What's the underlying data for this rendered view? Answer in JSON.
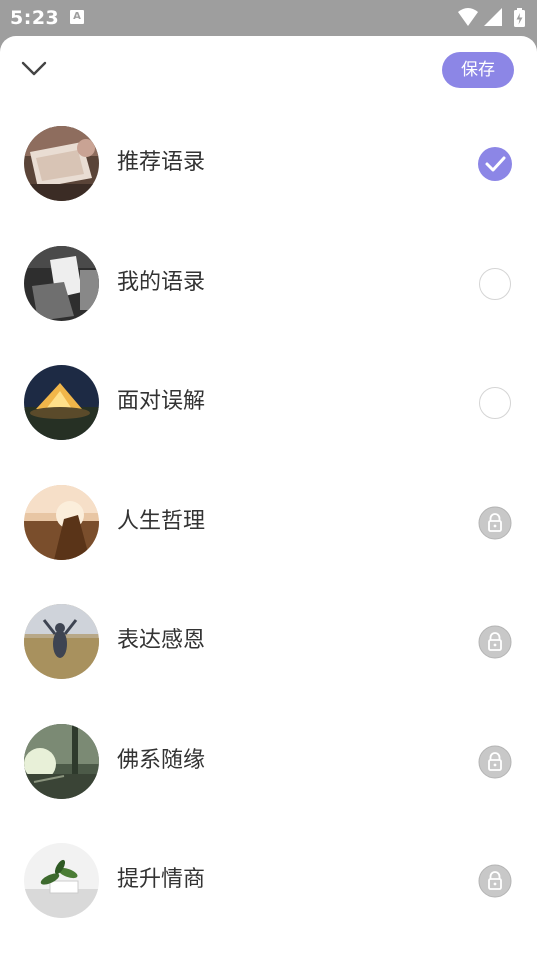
{
  "status_bar": {
    "time": "5:23",
    "notification_letter": "A"
  },
  "header": {
    "close_icon": "chevron-down-icon",
    "save_label": "保存"
  },
  "colors": {
    "accent": "#8c86e6",
    "scrim": "#9e9e9e",
    "lock_gray": "#c8c8c8"
  },
  "items": [
    {
      "label": "推荐语录",
      "state": "selected"
    },
    {
      "label": "我的语录",
      "state": "unselected"
    },
    {
      "label": "面对误解",
      "state": "unselected"
    },
    {
      "label": "人生哲理",
      "state": "locked"
    },
    {
      "label": "表达感恩",
      "state": "locked"
    },
    {
      "label": "佛系随缘",
      "state": "locked"
    },
    {
      "label": "提升情商",
      "state": "locked"
    }
  ]
}
